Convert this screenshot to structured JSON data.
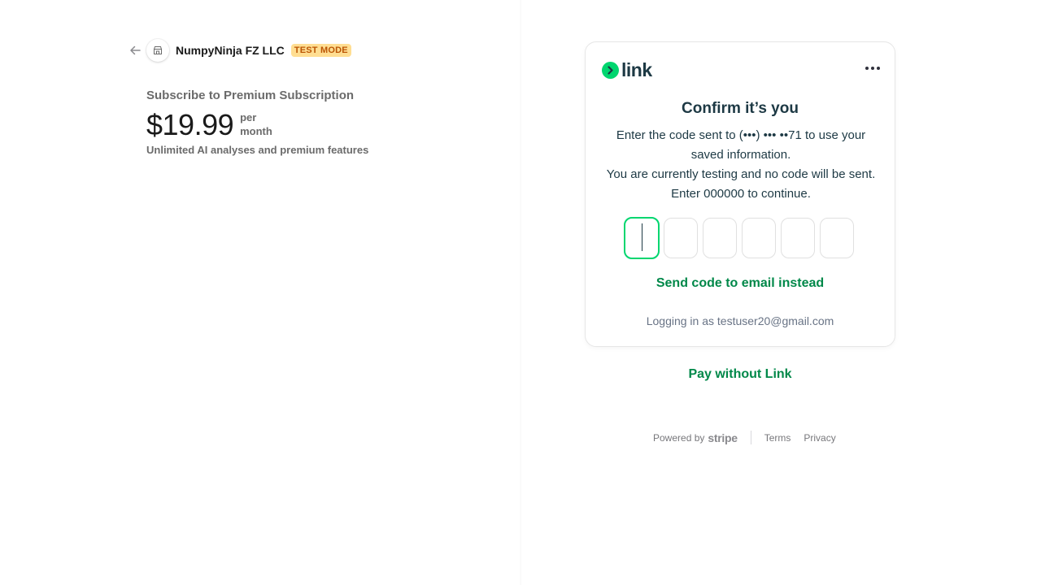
{
  "header": {
    "merchant_name": "NumpyNinja FZ LLC",
    "test_badge": "TEST MODE"
  },
  "product": {
    "title": "Subscribe to Premium Subscription",
    "price": "$19.99",
    "period_line1": "per",
    "period_line2": "month",
    "description": "Unlimited AI analyses and premium features"
  },
  "link_card": {
    "logo_text": "link",
    "title": "Confirm it’s you",
    "body_line1": "Enter the code sent to (•••) ••• ••71 to use your saved information.",
    "body_line2": "You are currently testing and no code will be sent. Enter 000000 to continue.",
    "otp_values": [
      "",
      "",
      "",
      "",
      "",
      ""
    ],
    "send_email_label": "Send code to email instead",
    "logging_in": "Logging in as testuser20@gmail.com"
  },
  "pay_without_label": "Pay without Link",
  "footer": {
    "powered_by": "Powered by",
    "stripe": "stripe",
    "terms": "Terms",
    "privacy": "Privacy"
  },
  "colors": {
    "link_green": "#00d66f",
    "action_green": "#008849",
    "badge_bg": "#ffde92",
    "badge_text": "#bb5504"
  }
}
